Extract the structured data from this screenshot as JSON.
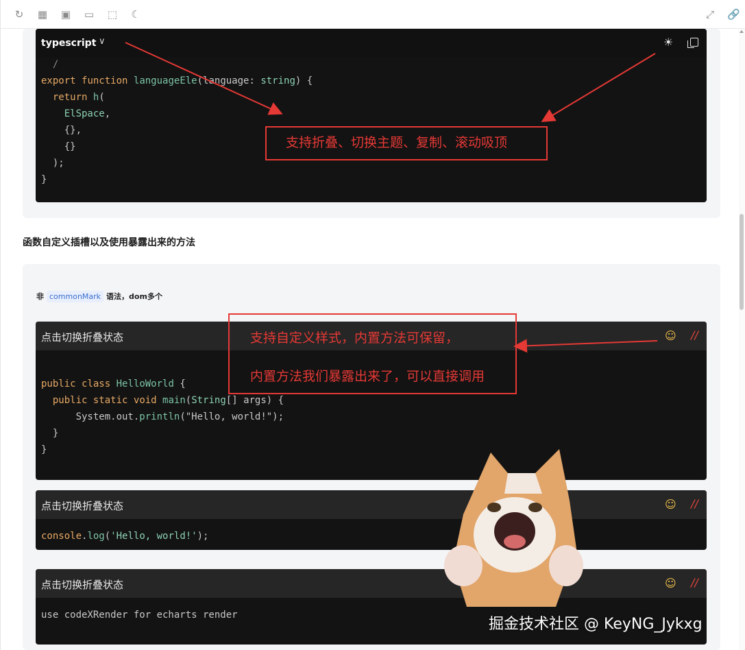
{
  "toolbar": {
    "icons": [
      "refresh-icon",
      "grid-icon",
      "window-icon",
      "layout-icon",
      "select-icon",
      "moon-icon",
      "fullscreen-icon",
      "link-icon"
    ]
  },
  "block1": {
    "language": "typescript",
    "code_lines": [
      {
        "parts": [
          [
            "k",
            "export"
          ],
          [
            "s",
            " "
          ],
          [
            "k",
            "function"
          ],
          [
            "s",
            " languageEle("
          ],
          [
            "s",
            "language"
          ],
          [
            "s",
            ": "
          ],
          [
            "s",
            "string"
          ],
          [
            "s",
            ") {"
          ]
        ]
      },
      {
        "parts": [
          [
            "s",
            "  "
          ],
          [
            "k",
            "return"
          ],
          [
            "s",
            " h("
          ]
        ]
      },
      {
        "parts": [
          [
            "s",
            "    "
          ],
          [
            "s",
            "ElSpace,"
          ]
        ]
      },
      {
        "parts": [
          [
            "s",
            "    {},"
          ]
        ]
      },
      {
        "parts": [
          [
            "s",
            "    {}"
          ]
        ]
      },
      {
        "parts": [
          [
            "s",
            "  );"
          ]
        ]
      },
      {
        "parts": [
          [
            "s",
            "}"
          ]
        ]
      }
    ]
  },
  "annotation1": {
    "text": "支持折叠、切换主题、复制、滚动吸顶"
  },
  "section_heading": "函数自定义插槽以及使用暴露出来的方法",
  "note": {
    "prefix": "非",
    "tag": "commonMark",
    "suffix": "语法，dom多个"
  },
  "annotation2": {
    "line1": "支持自定义样式，内置方法可保留，",
    "line2": "内置方法我们暴露出来了，可以直接调用"
  },
  "blocks": [
    {
      "title": "点击切换折叠状态",
      "code": "java"
    },
    {
      "title": "点击切换折叠状态",
      "code": "console"
    },
    {
      "title": "点击切换折叠状态",
      "code": "plain"
    }
  ],
  "code_java": {
    "l1": "public class HelloWorld {",
    "l2": "  public static void main(String[] args) {",
    "l3": "      System.out.println(\"Hello, world!\");",
    "l4": "  }",
    "l5": "}"
  },
  "code_console": "console.log('Hello, world!');",
  "code_plain": "use codeXRender for echarts render",
  "watermark": "掘金技术社区 @ KeyNG_Jykxg",
  "colors": {
    "accent_red": "#e53935",
    "code_bg": "#131313",
    "header_bg": "#262626"
  }
}
